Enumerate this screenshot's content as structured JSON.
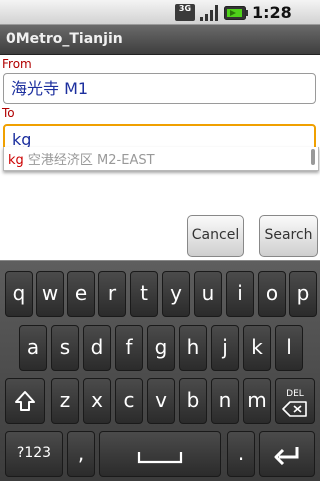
{
  "status_bar": {
    "network": "3G",
    "time": "1:28 PM",
    "icons": [
      "network-3g-icon",
      "signal-icon",
      "battery-icon"
    ]
  },
  "app": {
    "title": "0Metro_Tianjin"
  },
  "form": {
    "from_label": "From",
    "from_value": "海光寺 M1",
    "to_label": "To",
    "to_value": "kg",
    "cancel_label": "Cancel",
    "search_label": "Search"
  },
  "autocomplete": {
    "match": "kg",
    "rest": " 空港经济区 M2-EAST"
  },
  "keyboard": {
    "row1": [
      "q",
      "w",
      "e",
      "r",
      "t",
      "y",
      "u",
      "i",
      "o",
      "p"
    ],
    "row2": [
      "a",
      "s",
      "d",
      "f",
      "g",
      "h",
      "j",
      "k",
      "l"
    ],
    "row3": [
      "z",
      "x",
      "c",
      "v",
      "b",
      "n",
      "m"
    ],
    "sym_label": "?123",
    "comma_label": ",",
    "period_label": ".",
    "del_label": "DEL"
  },
  "colors": {
    "label_red": "#b00000",
    "focus_orange": "#f0a000",
    "value_blue": "#1c2f9e"
  }
}
